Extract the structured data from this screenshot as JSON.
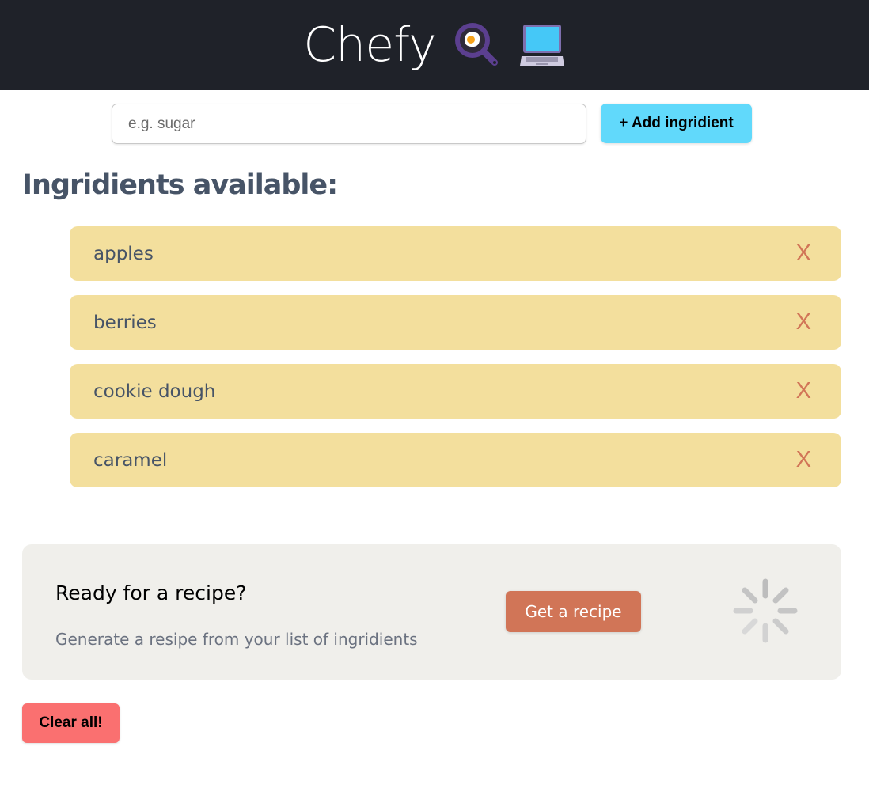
{
  "header": {
    "title": "Chefy",
    "icons": [
      "frying-pan-egg-icon",
      "laptop-icon"
    ]
  },
  "form": {
    "placeholder": "e.g. sugar",
    "value": "",
    "add_label": "+ Add ingridient"
  },
  "ingredients": {
    "heading": "Ingridients available:",
    "remove_label": "X",
    "items": [
      "apples",
      "berries",
      "cookie dough",
      "caramel"
    ]
  },
  "recipe": {
    "title": "Ready for a recipe?",
    "description": "Generate a resipe from your list of ingridients",
    "button": "Get a recipe",
    "loading_icon": "spinner-icon"
  },
  "clear_label": "Clear all!",
  "colors": {
    "header": "#1f2229",
    "add": "#61d9fb",
    "item": "#f3df9d",
    "accent": "#d17557",
    "clear": "#fa7070"
  }
}
